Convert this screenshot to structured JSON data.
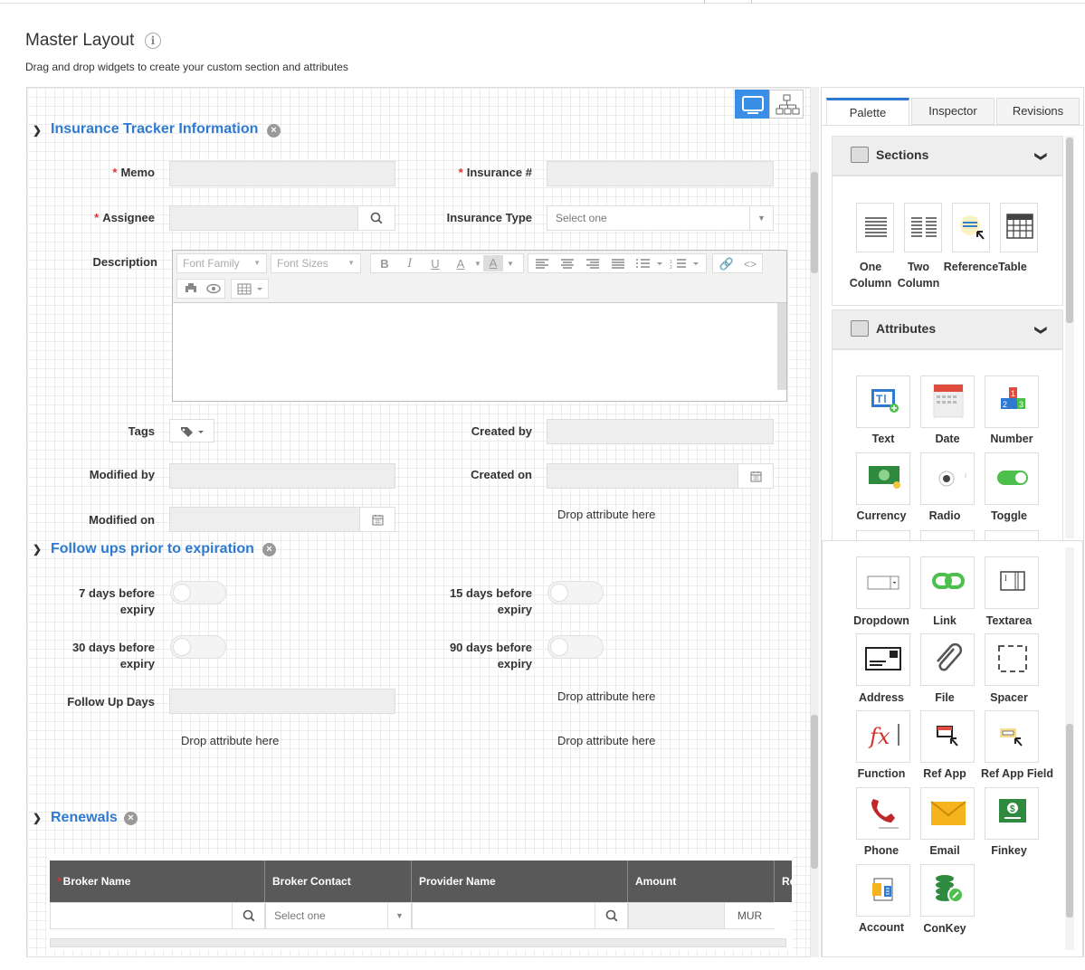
{
  "page": {
    "title": "Master Layout",
    "subtitle": "Drag and drop widgets to create your custom section and attributes"
  },
  "sections": {
    "insurance": {
      "title": "Insurance Tracker Information",
      "memo_label": "Memo",
      "insurance_no_label": "Insurance #",
      "assignee_label": "Assignee",
      "insurance_type_label": "Insurance Type",
      "insurance_type_placeholder": "Select one",
      "description_label": "Description",
      "font_family": "Font Family",
      "font_sizes": "Font Sizes",
      "tags_label": "Tags",
      "created_by_label": "Created by",
      "modified_by_label": "Modified by",
      "created_on_label": "Created on",
      "modified_on_label": "Modified on",
      "drop_here": "Drop attribute here"
    },
    "followups": {
      "title": "Follow ups prior to expiration",
      "d7_label_1": "7 days before",
      "d7_label_2": "expiry",
      "d15_label_1": "15 days before",
      "d15_label_2": "expiry",
      "d30_label_1": "30 days before",
      "d30_label_2": "expiry",
      "d90_label_1": "90 days before",
      "d90_label_2": "expiry",
      "followup_days_label": "Follow Up Days",
      "drop_here": "Drop attribute here"
    },
    "renewals": {
      "title": "Renewals",
      "columns": [
        "Broker Name",
        "Broker Contact",
        "Provider Name",
        "Amount",
        "Re"
      ],
      "broker_contact_placeholder": "Select one",
      "currency": "MUR"
    }
  },
  "panel": {
    "tabs": [
      "Palette",
      "Inspector",
      "Revisions"
    ],
    "sections_header": "Sections",
    "attributes_header": "Attributes",
    "section_widgets": [
      {
        "line1": "One",
        "line2": "Column"
      },
      {
        "line1": "Two",
        "line2": "Column"
      },
      {
        "line1": "Reference",
        "line2": ""
      },
      {
        "line1": "Table",
        "line2": ""
      }
    ],
    "attribute_widgets": [
      "Text",
      "Date",
      "Number",
      "Currency",
      "Radio",
      "Toggle",
      "Dropdown",
      "Link",
      "Textarea",
      "Address",
      "File",
      "Spacer",
      "Function",
      "Ref App",
      "Ref App Field",
      "Phone",
      "Email",
      "Finkey",
      "Account",
      "ConKey"
    ],
    "colors": {
      "accent": "#2f7ad1",
      "grid_header": "#595959",
      "toggle_on": "#4cbf4c"
    }
  }
}
